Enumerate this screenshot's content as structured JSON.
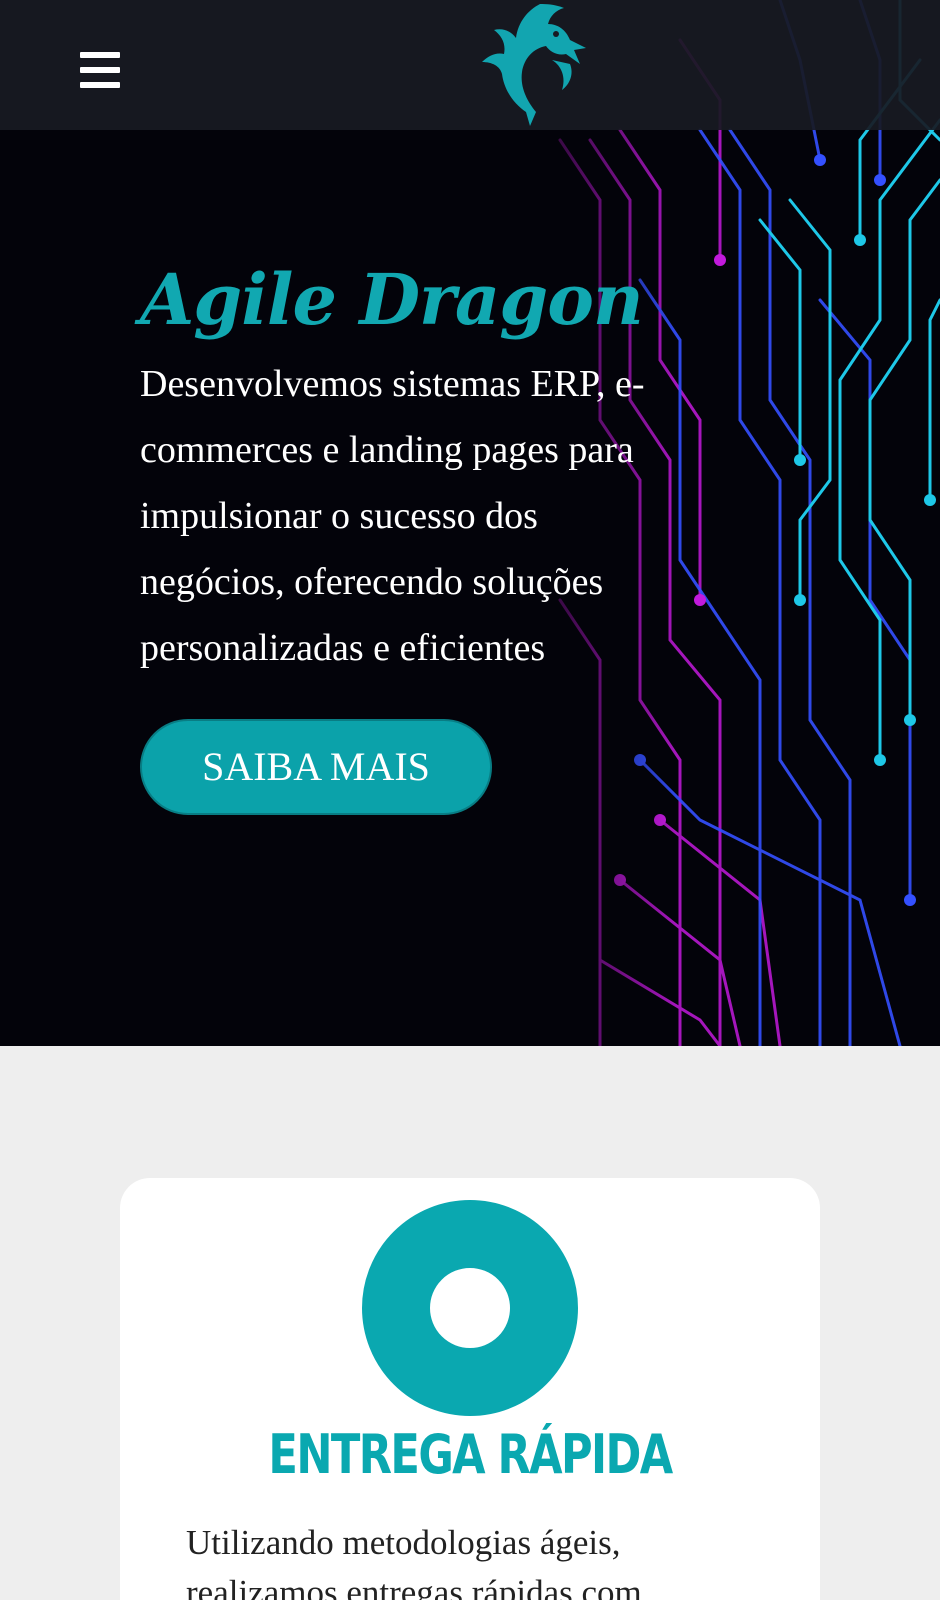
{
  "header": {
    "menu_icon": "hamburger-menu-icon",
    "logo_icon": "dragon-logo-icon"
  },
  "hero": {
    "brand": "Agile Dragon",
    "tagline": "Desenvolvemos sistemas ERP, e-commerces e landing pages para impulsionar o sucesso dos negócios, oferecendo soluções personalizadas e eficientes",
    "cta_label": "SAIBA MAIS",
    "background_image": "circuit-board-background"
  },
  "features": [
    {
      "icon": "ring-icon",
      "title": "ENTREGA RÁPIDA",
      "text": "Utilizando metodologias ágeis, realizamos entregas rápidas com"
    }
  ],
  "colors": {
    "accent": "#0aa8b0",
    "header_bg": "#181a22",
    "hero_bg": "#03030a",
    "page_bg": "#eeeeee",
    "card_bg": "#ffffff",
    "circuit_cyan": "#1ec8e8",
    "circuit_blue": "#3050ff",
    "circuit_magenta": "#d21adc"
  }
}
